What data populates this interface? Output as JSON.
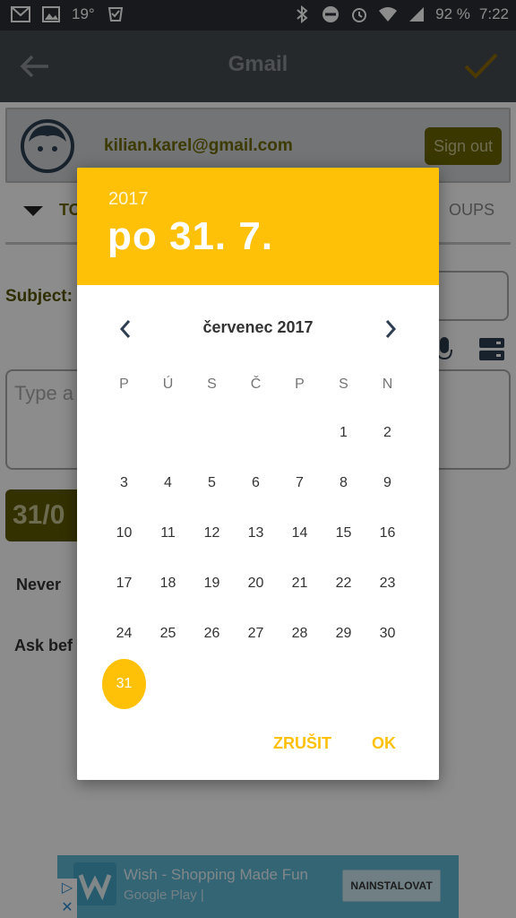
{
  "status_bar": {
    "temperature": "19°",
    "battery": "92 %",
    "time": "7:22"
  },
  "app_bar": {
    "title": "Gmail"
  },
  "background": {
    "email": "kilian.karel@gmail.com",
    "sign_out": "Sign out",
    "to_label": "TO",
    "groups_label": "OUPS",
    "subject_label": "Subject:",
    "body_placeholder": "Type a",
    "date_chip": "31/0",
    "never_label": "Never",
    "ask_label": "Ask bef"
  },
  "ad": {
    "title": "Wish - Shopping Made Fun",
    "subtitle": "Google Play  |",
    "install_button": "NAINSTALOVAT"
  },
  "date_picker": {
    "year": "2017",
    "selected_date": "po 31. 7.",
    "month_label": "červenec 2017",
    "weekdays": [
      "P",
      "Ú",
      "S",
      "Č",
      "P",
      "S",
      "N"
    ],
    "leading_blank_days": 5,
    "days": [
      "1",
      "2",
      "3",
      "4",
      "5",
      "6",
      "7",
      "8",
      "9",
      "10",
      "11",
      "12",
      "13",
      "14",
      "15",
      "16",
      "17",
      "18",
      "19",
      "20",
      "21",
      "22",
      "23",
      "24",
      "25",
      "26",
      "27",
      "28",
      "29",
      "30",
      "31"
    ],
    "selected_day": "31",
    "cancel_label": "ZRUŠIT",
    "ok_label": "OK",
    "accent_color": "#ffc108"
  }
}
